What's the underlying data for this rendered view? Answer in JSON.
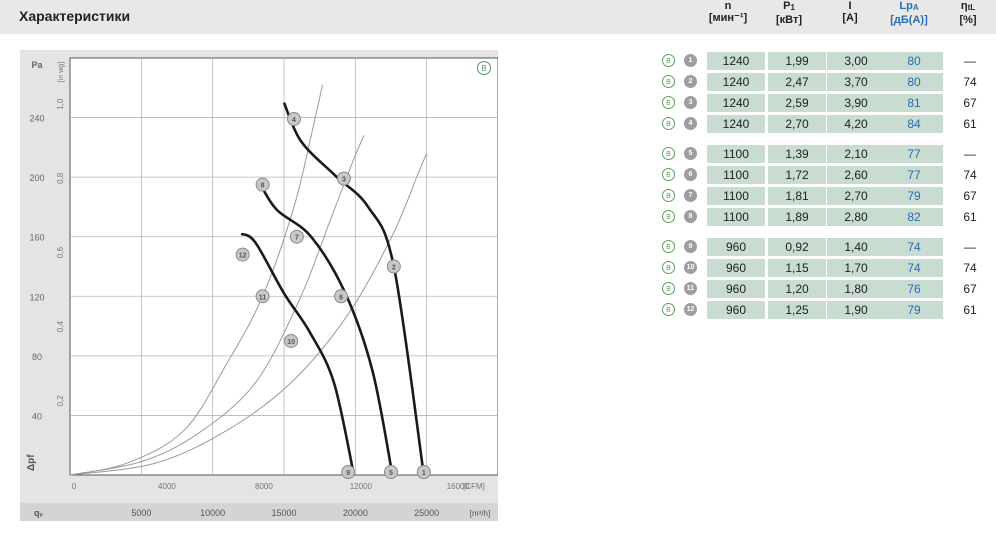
{
  "page": {
    "title": "Характеристики"
  },
  "columns": [
    {
      "symbol": "n",
      "unit": "[мин⁻¹]",
      "color": "#222222"
    },
    {
      "symbol": "P",
      "sub": "1",
      "unit": "[кВт]",
      "color": "#222222"
    },
    {
      "symbol": "I",
      "unit": "[A]",
      "color": "#222222"
    },
    {
      "symbol": "Lp",
      "sub": "A",
      "unit": "[дБ(A)]",
      "color": "#2a6db0"
    },
    {
      "symbol": "η",
      "sub": "tL",
      "unit": "[%]",
      "color": "#222222"
    }
  ],
  "rows": [
    {
      "marker": "B",
      "num": "1",
      "n": "1240",
      "p1": "1,99",
      "i": "3,00",
      "lpa": "80",
      "eta": "—"
    },
    {
      "marker": "B",
      "num": "2",
      "n": "1240",
      "p1": "2,47",
      "i": "3,70",
      "lpa": "80",
      "eta": "74"
    },
    {
      "marker": "B",
      "num": "3",
      "n": "1240",
      "p1": "2,59",
      "i": "3,90",
      "lpa": "81",
      "eta": "67"
    },
    {
      "marker": "B",
      "num": "4",
      "n": "1240",
      "p1": "2,70",
      "i": "4,20",
      "lpa": "84",
      "eta": "61"
    },
    {
      "marker": "B",
      "num": "5",
      "n": "1100",
      "p1": "1,39",
      "i": "2,10",
      "lpa": "77",
      "eta": "—"
    },
    {
      "marker": "B",
      "num": "6",
      "n": "1100",
      "p1": "1,72",
      "i": "2,60",
      "lpa": "77",
      "eta": "74"
    },
    {
      "marker": "B",
      "num": "7",
      "n": "1100",
      "p1": "1,81",
      "i": "2,70",
      "lpa": "79",
      "eta": "67"
    },
    {
      "marker": "B",
      "num": "8",
      "n": "1100",
      "p1": "1,89",
      "i": "2,80",
      "lpa": "82",
      "eta": "61"
    },
    {
      "marker": "B",
      "num": "9",
      "n": "960",
      "p1": "0,92",
      "i": "1,40",
      "lpa": "74",
      "eta": "—"
    },
    {
      "marker": "B",
      "num": "10",
      "n": "960",
      "p1": "1,15",
      "i": "1,70",
      "lpa": "74",
      "eta": "74"
    },
    {
      "marker": "B",
      "num": "11",
      "n": "960",
      "p1": "1,20",
      "i": "1,80",
      "lpa": "76",
      "eta": "67"
    },
    {
      "marker": "B",
      "num": "12",
      "n": "960",
      "p1": "1,25",
      "i": "1,90",
      "lpa": "79",
      "eta": "61"
    }
  ],
  "chart_data": {
    "type": "line",
    "title": "",
    "badge": "B",
    "x_top_ticks": [
      "0",
      "4000",
      "8000",
      "12000",
      "16000"
    ],
    "x_top_unit": "[CFM]",
    "x_bottom_ticks": [
      "5000",
      "10000",
      "15000",
      "20000",
      "25000"
    ],
    "x_bottom_unit": "[m³/h]",
    "x_bottom_symbol": "qᵥ",
    "y_left_ticks": [
      "40",
      "80",
      "120",
      "160",
      "200",
      "240"
    ],
    "y_left_unit": "Pa",
    "y_left_symbol": "Δpf",
    "y_inner_ticks": [
      "0,2",
      "0,4",
      "0,6",
      "0,8",
      "1,0"
    ],
    "y_inner_unit": "[in wg]",
    "xlim": [
      0,
      30000
    ],
    "ylim": [
      0,
      280
    ],
    "grid": true,
    "fan_curves": [
      {
        "name": "960",
        "points": [
          [
            12000,
            162
          ],
          [
            13000,
            156
          ],
          [
            15000,
            122
          ],
          [
            16800,
            96
          ],
          [
            18500,
            62
          ],
          [
            19900,
            0
          ]
        ]
      },
      {
        "name": "1100",
        "points": [
          [
            13300,
            196
          ],
          [
            14500,
            178
          ],
          [
            16900,
            160
          ],
          [
            19300,
            122
          ],
          [
            21200,
            70
          ],
          [
            22600,
            0
          ]
        ]
      },
      {
        "name": "1240",
        "points": [
          [
            15000,
            250
          ],
          [
            16200,
            224
          ],
          [
            18600,
            201
          ],
          [
            20900,
            180
          ],
          [
            22700,
            140
          ],
          [
            24800,
            0
          ]
        ]
      }
    ],
    "system_curves": [
      {
        "points": [
          [
            0,
            0
          ],
          [
            4000,
            8
          ],
          [
            8000,
            30
          ],
          [
            11000,
            75
          ],
          [
            13500,
            120
          ],
          [
            15700,
            180
          ],
          [
            17000,
            232
          ],
          [
            17700,
            262
          ]
        ]
      },
      {
        "points": [
          [
            0,
            0
          ],
          [
            5000,
            9
          ],
          [
            9000,
            28
          ],
          [
            13000,
            62
          ],
          [
            16100,
            118
          ],
          [
            18200,
            170
          ],
          [
            19800,
            210
          ],
          [
            20600,
            228
          ]
        ]
      },
      {
        "points": [
          [
            0,
            0
          ],
          [
            6000,
            8
          ],
          [
            11000,
            30
          ],
          [
            15500,
            62
          ],
          [
            19500,
            108
          ],
          [
            22600,
            161
          ],
          [
            24300,
            200
          ],
          [
            25000,
            216
          ]
        ]
      }
    ],
    "markers": [
      {
        "label": "1",
        "x": 24800,
        "y": 0
      },
      {
        "label": "2",
        "x": 22700,
        "y": 140
      },
      {
        "label": "3",
        "x": 19200,
        "y": 199
      },
      {
        "label": "4",
        "x": 15700,
        "y": 239
      },
      {
        "label": "5",
        "x": 22500,
        "y": 0
      },
      {
        "label": "6",
        "x": 19000,
        "y": 120
      },
      {
        "label": "7",
        "x": 15900,
        "y": 160
      },
      {
        "label": "8",
        "x": 13500,
        "y": 195
      },
      {
        "label": "9",
        "x": 19500,
        "y": 0
      },
      {
        "label": "10",
        "x": 15500,
        "y": 90
      },
      {
        "label": "11",
        "x": 13500,
        "y": 120
      },
      {
        "label": "12",
        "x": 12100,
        "y": 148
      }
    ]
  }
}
